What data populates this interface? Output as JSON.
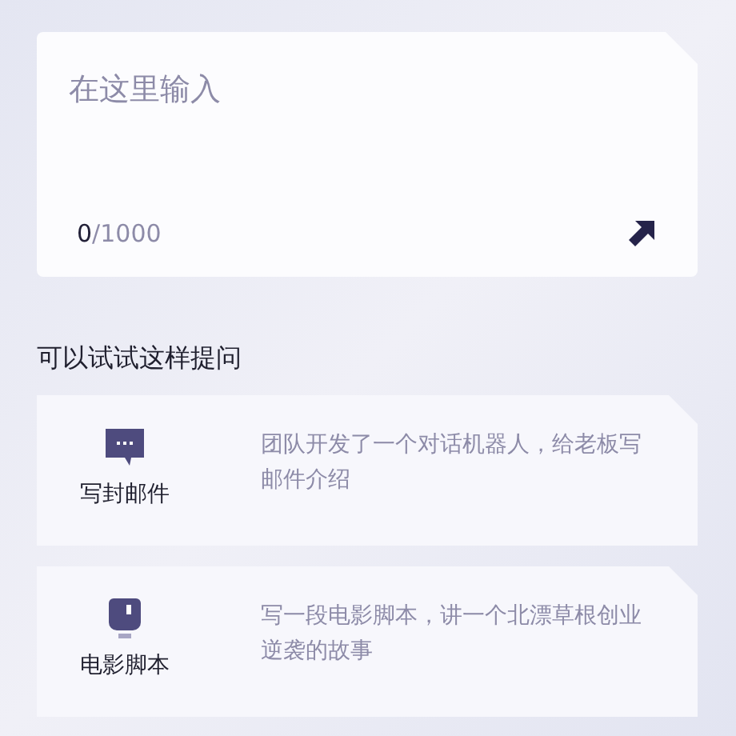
{
  "input": {
    "placeholder": "在这里输入",
    "count": "0",
    "limit": "/1000"
  },
  "suggestions_title": "可以试试这样提问",
  "suggestions": [
    {
      "kind": "email",
      "label": "写封邮件",
      "text": "团队开发了一个对话机器人，给老板写邮件介绍"
    },
    {
      "kind": "script",
      "label": "电影脚本",
      "text": "写一段电影脚本，讲一个北漂草根创业逆袭的故事"
    }
  ]
}
